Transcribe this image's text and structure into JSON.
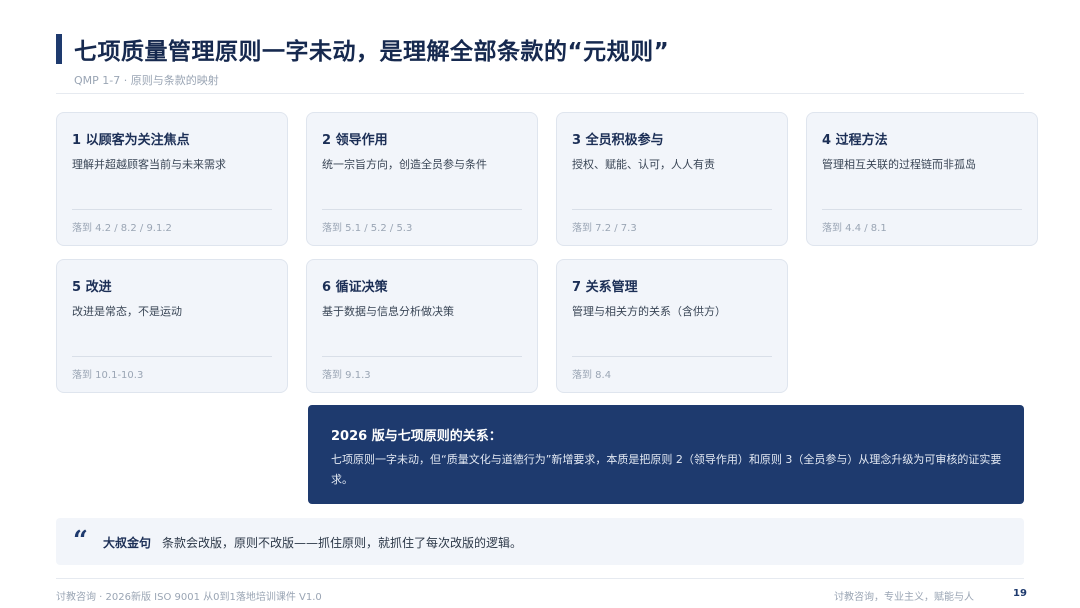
{
  "header": {
    "title": "七项质量管理原则一字未动，是理解全部条款的“元规则”",
    "subtitle": "QMP 1-7 · 原则与条款的映射"
  },
  "principles": [
    {
      "title": "1 以顾客为关注焦点",
      "desc": "理解并超越顾客当前与未来需求",
      "ref": "落到 4.2 / 8.2 / 9.1.2"
    },
    {
      "title": "2 领导作用",
      "desc": "统一宗旨方向，创造全员参与条件",
      "ref": "落到 5.1 / 5.2 / 5.3"
    },
    {
      "title": "3 全员积极参与",
      "desc": "授权、赋能、认可，人人有责",
      "ref": "落到 7.2 / 7.3"
    },
    {
      "title": "4 过程方法",
      "desc": "管理相互关联的过程链而非孤岛",
      "ref": "落到 4.4 / 8.1"
    },
    {
      "title": "5 改进",
      "desc": "改进是常态，不是运动",
      "ref": "落到 10.1-10.3"
    },
    {
      "title": "6 循证决策",
      "desc": "基于数据与信息分析做决策",
      "ref": "落到 9.1.3"
    },
    {
      "title": "7 关系管理",
      "desc": "管理与相关方的关系（含供方）",
      "ref": "落到 8.4"
    }
  ],
  "relation": {
    "title": "2026 版与七项原则的关系：",
    "body": "七项原则一字未动，但“质量文化与道德行为”新增要求，本质是把原则 2（领导作用）和原则 3（全员参与）从理念升级为可审核的证实要求。"
  },
  "quote": {
    "icon": "quote-mark-icon",
    "label": "大叔金句",
    "text": "条款会改版，原则不改版——抓住原则，就抓住了每次改版的逻辑。"
  },
  "footer": {
    "left": "讨教咨询 · 2026新版 ISO 9001 从0到1落地培训课件 V1.0",
    "right": "讨教咨询，专业主义，赋能与人",
    "page": "19"
  },
  "colors": {
    "accent": "#1e3a6e",
    "card_bg": "#f2f5fa"
  }
}
